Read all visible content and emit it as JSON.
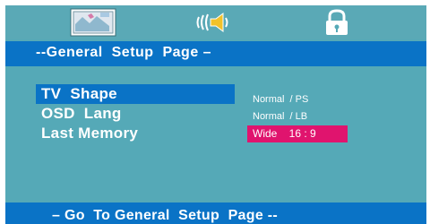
{
  "tabs": [
    {
      "icon": "picture-icon",
      "active": true
    },
    {
      "icon": "speaker-icon",
      "active": false
    },
    {
      "icon": "lock-icon",
      "active": false
    }
  ],
  "header": {
    "title": "--General  Setup  Page –"
  },
  "menu": {
    "items": [
      {
        "label": "TV  Shape",
        "selected": true
      },
      {
        "label": "OSD  Lang",
        "selected": false
      },
      {
        "label": "Last Memory",
        "selected": false
      }
    ]
  },
  "options": {
    "items": [
      {
        "label": "Normal  / PS",
        "selected": false
      },
      {
        "label": "Normal  / LB",
        "selected": false
      },
      {
        "label": "Wide    16 : 9",
        "selected": true
      }
    ]
  },
  "footer": {
    "text": "– Go  To General  Setup  Page --"
  },
  "colors": {
    "panel": "#55a9b7",
    "bar": "#0a73c6",
    "highlight": "#e0146e"
  }
}
